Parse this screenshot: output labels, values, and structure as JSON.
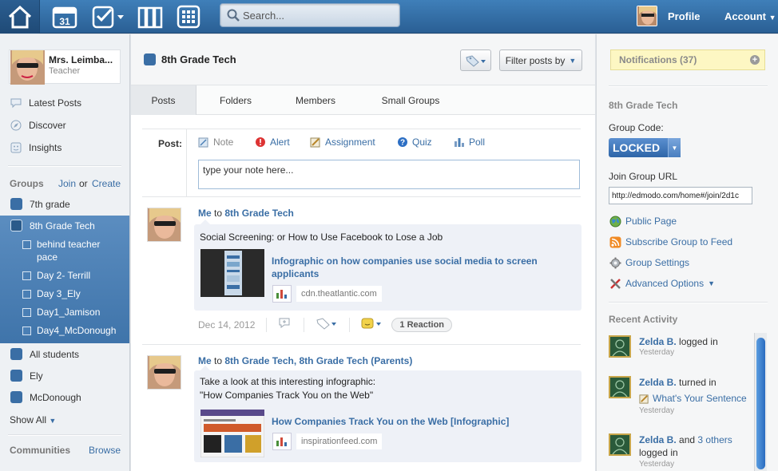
{
  "topbar": {
    "search_placeholder": "Search...",
    "calendar_day": "31",
    "profile_label": "Profile",
    "account_label": "Account"
  },
  "icons": {
    "home": "home-icon",
    "calendar": "calendar-icon",
    "assignments": "checklist-icon",
    "library": "books-icon",
    "apps": "grid-icon",
    "search": "search-icon"
  },
  "colors": {
    "topbar": "#3a74ae",
    "accent": "#3a6ea5",
    "selected_group": "#4a7fb5",
    "notification_bg": "#fdf7c3"
  },
  "user": {
    "name": "Mrs. Leimba...",
    "role": "Teacher"
  },
  "sidebar": {
    "nav": [
      {
        "label": "Latest Posts",
        "icon": "speech-bubble-icon"
      },
      {
        "label": "Discover",
        "icon": "compass-icon"
      },
      {
        "label": "Insights",
        "icon": "smiley-icon"
      }
    ],
    "groups_heading": "Groups",
    "join_label": "Join",
    "or_label": "or",
    "create_label": "Create",
    "groups": [
      {
        "label": "7th grade"
      },
      {
        "label": "8th Grade Tech"
      },
      {
        "label": "All students"
      },
      {
        "label": "Ely"
      },
      {
        "label": "McDonough"
      }
    ],
    "subgroups": [
      {
        "label": "behind teacher pace"
      },
      {
        "label": "Day 2- Terrill"
      },
      {
        "label": "Day 3_Ely"
      },
      {
        "label": "Day1_Jamison"
      },
      {
        "label": "Day4_McDonough"
      }
    ],
    "show_all": "Show All",
    "communities_heading": "Communities",
    "browse_label": "Browse"
  },
  "center": {
    "group_title": "8th Grade Tech",
    "filter_label": "Filter posts by",
    "tabs": [
      {
        "label": "Posts"
      },
      {
        "label": "Folders"
      },
      {
        "label": "Members"
      },
      {
        "label": "Small Groups"
      }
    ],
    "composer": {
      "post_label": "Post:",
      "types": [
        {
          "label": "Note"
        },
        {
          "label": "Alert"
        },
        {
          "label": "Assignment"
        },
        {
          "label": "Quiz"
        },
        {
          "label": "Poll"
        }
      ],
      "note_value": "type your note here..."
    },
    "posts": [
      {
        "sender": "Me",
        "to": "to",
        "recipients": "8th Grade Tech",
        "text_line1": "Social Screening: or How to Use Facebook to Lose a Job",
        "link_title_line1": "Infographic on how companies use social media to screen",
        "link_title_line2": "applicants",
        "domain": "cdn.theatlantic.com",
        "date": "Dec 14, 2012",
        "reactions": "1 Reaction"
      },
      {
        "sender": "Me",
        "to": "to",
        "recipients": "8th Grade Tech, 8th Grade Tech (Parents)",
        "text_line1": "Take a look at this interesting infographic:",
        "text_line2": "\"How Companies Track You on the Web\"",
        "link_title_line1": "How Companies Track You on the Web [Infographic]",
        "domain": "inspirationfeed.com"
      }
    ]
  },
  "right": {
    "notifications": "Notifications (37)",
    "group_title": "8th Grade Tech",
    "code_label": "Group Code:",
    "code_value": "LOCKED",
    "url_label": "Join Group URL",
    "url_value": "http://edmodo.com/home#/join/2d1c",
    "links": [
      {
        "label": "Public Page",
        "icon": "globe-icon"
      },
      {
        "label": "Subscribe Group to Feed",
        "icon": "rss-icon"
      },
      {
        "label": "Group Settings",
        "icon": "gear-icon"
      },
      {
        "label": "Advanced Options",
        "icon": "tools-icon"
      }
    ],
    "recent_title": "Recent Activity",
    "activity": [
      {
        "user": "Zelda B.",
        "action": "logged in",
        "time": "Yesterday"
      },
      {
        "user": "Zelda B.",
        "action": "turned in",
        "item": "What's Your Sentence",
        "time": "Yesterday"
      },
      {
        "user": "Zelda B.",
        "and": "and",
        "others": "3 others",
        "action": "logged in",
        "time": "Yesterday"
      }
    ]
  }
}
